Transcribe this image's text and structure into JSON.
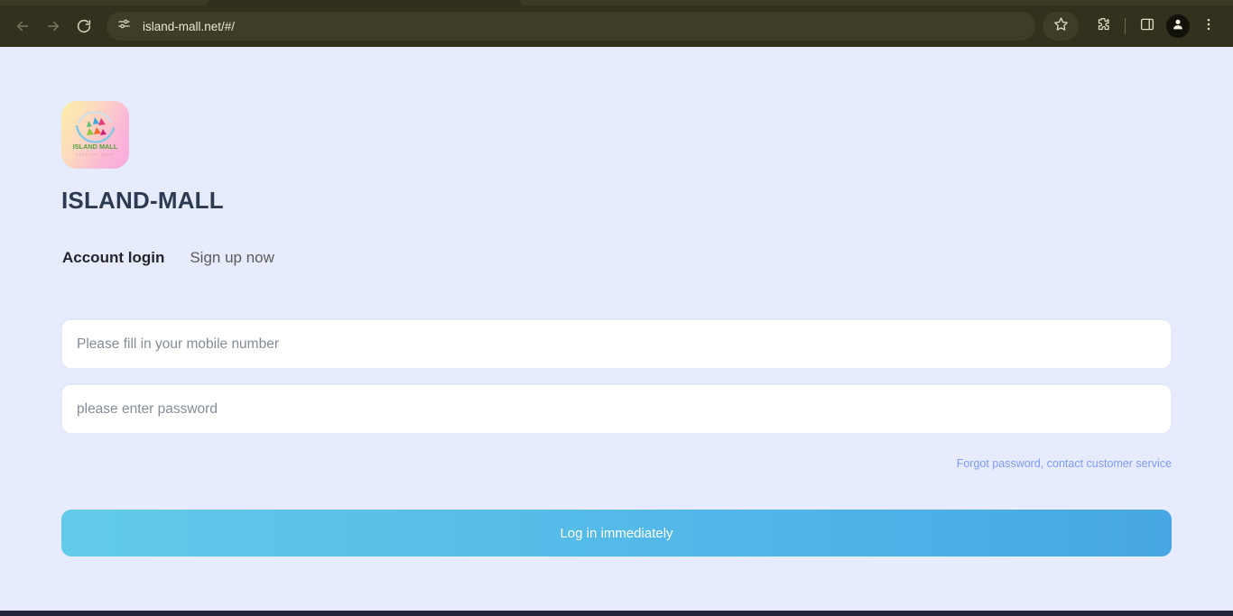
{
  "browser": {
    "url": "island-mall.net/#/",
    "back_label": "Back",
    "forward_label": "Forward",
    "reload_label": "Reload",
    "site_info_label": "View site information",
    "bookmark_label": "Bookmark this tab",
    "extensions_label": "Extensions",
    "side_panel_label": "Side panel",
    "profile_label": "Profile",
    "menu_label": "Customize and control Google Chrome",
    "colors": {
      "toolbar": "#32311d",
      "omnibox": "#3e3d25",
      "url_text": "#e8e6d6"
    }
  },
  "page": {
    "background": "#e6ebfe",
    "brand": {
      "title": "ISLAND-MALL",
      "logo_text": "ISLAND MALL",
      "logo_subtext": "FESTIVAL SHOP",
      "logo_gradient_from": "#fdf0a6",
      "logo_gradient_to": "#f9a8e0"
    },
    "tabs": [
      {
        "label": "Account login",
        "active": true
      },
      {
        "label": "Sign up now",
        "active": false
      }
    ],
    "form": {
      "mobile": {
        "value": "",
        "placeholder": "Please fill in your mobile number"
      },
      "password": {
        "value": "",
        "placeholder": "please enter password"
      },
      "helper_link": "Forgot password, contact customer service",
      "helper_link_color": "#7f9bf2",
      "submit_label": "Log in immediately",
      "submit_gradient_from": "#62cbe9",
      "submit_gradient_to": "#48a7e4"
    }
  }
}
